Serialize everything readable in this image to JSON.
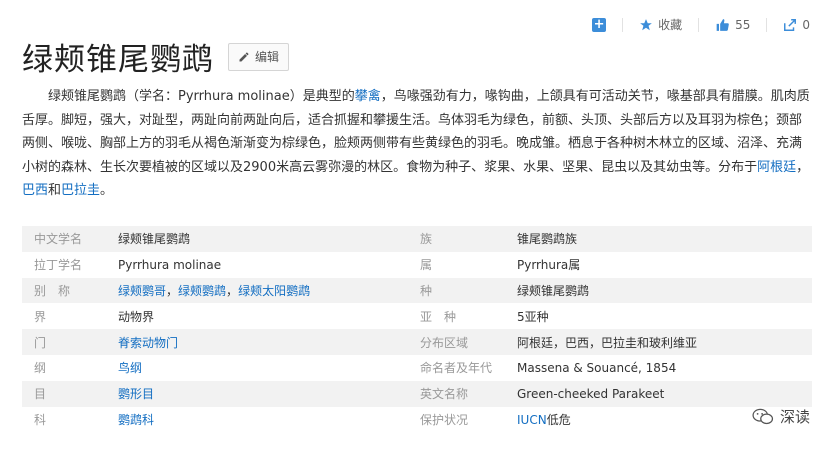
{
  "toolbar": {
    "add_icon": "plus-icon",
    "favorite_label": "收藏",
    "like_count": "55",
    "share_count": "0"
  },
  "title": "绿颊锥尾鹦鹉",
  "edit_label": "编辑",
  "summary": {
    "p1": "绿颊锥尾鹦鹉（学名：Pyrrhura molinae）是典型的",
    "link1": "攀禽",
    "p2": "，鸟喙强劲有力，喙钩曲，上颌具有可活动关节，喙基部具有腊膜。肌肉质舌厚。脚短，强大，对趾型，两趾向前两趾向后，适合抓握和攀援生活。鸟体羽毛为绿色，前额、头顶、头部后方以及耳羽为棕色；颈部两侧、喉咙、胸部上方的羽毛从褐色渐渐变为棕绿色，脸颊两侧带有些黄绿色的羽毛。晚成雏。栖息于各种树木林立的区域、沼泽、充满小树的森林、生长次要植被的区域以及2900米高云雾弥漫的林区。食物为种子、浆果、水果、坚果、昆虫以及其幼虫等。分布于",
    "link2": "阿根廷",
    "sep1": "，",
    "link3": "巴西",
    "sep2": "和",
    "link4": "巴拉圭",
    "end": "。"
  },
  "info": {
    "rows": [
      {
        "k1": "中文学名",
        "v1": "绿颊锥尾鹦鹉",
        "k2": "族",
        "v2": "锥尾鹦鹉族"
      },
      {
        "k1": "拉丁学名",
        "v1": "Pyrrhura molinae",
        "k2": "属",
        "v2": "Pyrrhura属"
      },
      {
        "k1": "别　称",
        "v1": "绿颊鹦哥，绿颊鹦鹉，绿颊太阳鹦鹉",
        "k2": "种",
        "v2": "绿颊锥尾鹦鹉"
      },
      {
        "k1": "界",
        "v1": "动物界",
        "k2": "亚　种",
        "v2": "5亚种"
      },
      {
        "k1": "门",
        "v1": "脊索动物门",
        "k2": "分布区域",
        "v2": "阿根廷，巴西，巴拉圭和玻利维亚"
      },
      {
        "k1": "纲",
        "v1": "鸟纲",
        "k2": "命名者及年代",
        "v2": "Massena & Souancé, 1854"
      },
      {
        "k1": "目",
        "v1": "鹦形目",
        "k2": "英文名称",
        "v2": "Green-cheeked Parakeet"
      },
      {
        "k1": "科",
        "v1": "鹦鹉科",
        "k2": "保护状况",
        "v2a": "IUCN",
        "v2b": "低危"
      }
    ],
    "alias_links": [
      "绿颊鹦哥",
      "绿颊鹦鹉",
      "绿颊太阳鹦鹉"
    ],
    "alias_sep": "，"
  },
  "watermark": {
    "label": "深读"
  },
  "colors": {
    "link": "#136ec2",
    "accent": "#3c8dd9",
    "row_alt": "#f2f2f2"
  }
}
